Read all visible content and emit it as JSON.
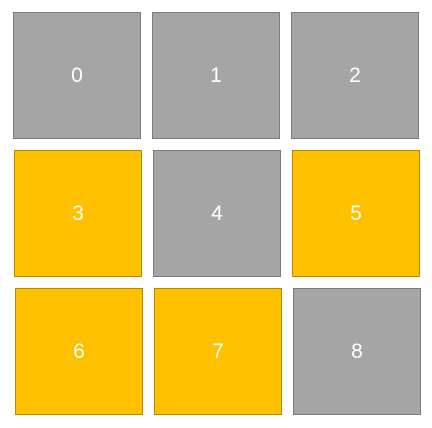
{
  "colors": {
    "gray": "#a5a5a5",
    "gold": "#ffc000",
    "text": "#ffffff"
  },
  "tiles": [
    {
      "label": "0",
      "state": "gray"
    },
    {
      "label": "1",
      "state": "gray"
    },
    {
      "label": "2",
      "state": "gray"
    },
    {
      "label": "3",
      "state": "gold"
    },
    {
      "label": "4",
      "state": "gray"
    },
    {
      "label": "5",
      "state": "gold"
    },
    {
      "label": "6",
      "state": "gold"
    },
    {
      "label": "7",
      "state": "gold"
    },
    {
      "label": "8",
      "state": "gray"
    }
  ]
}
